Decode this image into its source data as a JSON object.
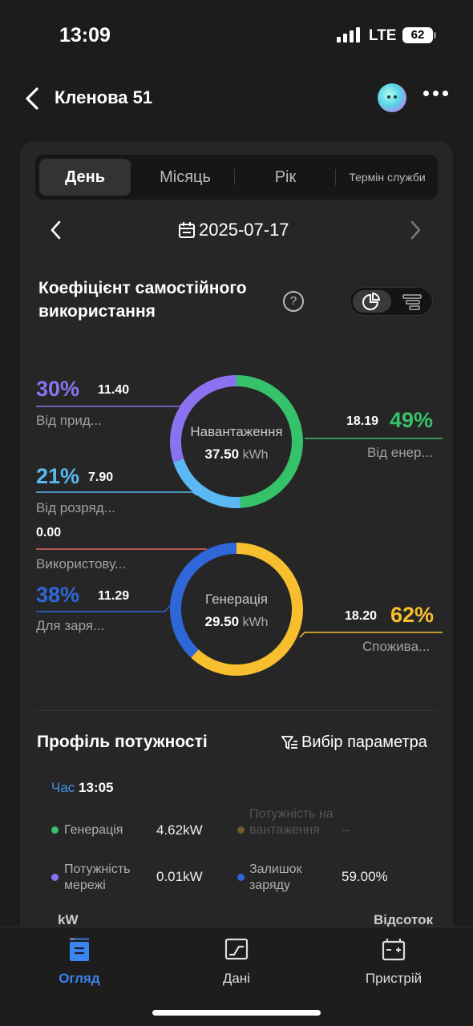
{
  "status": {
    "time": "13:09",
    "network": "LTE",
    "battery": "62"
  },
  "header": {
    "title": "Кленова 51"
  },
  "tabs": [
    {
      "label": "День",
      "active": true
    },
    {
      "label": "Місяць",
      "active": false
    },
    {
      "label": "Рік",
      "active": false
    },
    {
      "label": "Термін служби",
      "active": false
    }
  ],
  "date": "2025-07-17",
  "self_use": {
    "title": "Коефіцієнт самостійного використання",
    "load_ring": {
      "center_label": "Навантаження",
      "center_value": "37.50",
      "unit": "kWh",
      "segments": [
        {
          "label": "Від енер...",
          "pct": "49%",
          "pct_value": 49,
          "value": "18.19",
          "color": "#36c26a"
        },
        {
          "label": "Від розряд...",
          "pct": "21%",
          "pct_value": 21,
          "value": "7.90",
          "color": "#5ab8f2"
        },
        {
          "label": "Від прид...",
          "pct": "30%",
          "pct_value": 30,
          "value": "11.40",
          "color": "#8b72f0"
        }
      ]
    },
    "generation_ring": {
      "center_label": "Генерація",
      "center_value": "29.50",
      "unit": "kWh",
      "segments": [
        {
          "label": "Споживa...",
          "pct": "62%",
          "pct_value": 62,
          "value": "18.20",
          "color": "#f7bf2e"
        },
        {
          "label": "Для заря...",
          "pct": "38%",
          "pct_value": 38,
          "value": "11.29",
          "color": "#2f66d8"
        },
        {
          "label": "Використову...",
          "pct": "",
          "pct_value": 0,
          "value": "0.00",
          "color": "#e06868"
        }
      ]
    }
  },
  "profile": {
    "title": "Профіль потужності",
    "param_button": "Вибір параметра",
    "time_label": "Час",
    "time_value": "13:05",
    "legend": [
      {
        "label": "Генерація",
        "value": "4.62kW",
        "color": "#36c26a",
        "dim": false
      },
      {
        "label": "Потужність навантаження",
        "value": "--",
        "color": "#6e5a2a",
        "dim": true
      },
      {
        "label": "Потужність мережі",
        "value": "0.01kW",
        "color": "#8b72f0",
        "dim": false
      },
      {
        "label": "Залишок заряду",
        "value": "59.00%",
        "color": "#2f66d8",
        "dim": false
      }
    ],
    "axis_left": "kW",
    "axis_right": "Відсоток"
  },
  "bottom_nav": [
    {
      "label": "Огляд",
      "icon": "overview-icon",
      "active": true
    },
    {
      "label": "Дані",
      "icon": "chart-icon",
      "active": false
    },
    {
      "label": "Пристрій",
      "icon": "device-icon",
      "active": false
    }
  ],
  "colors": {
    "accent": "#3c84f0",
    "background": "#1c1c1c",
    "card": "#262626"
  }
}
